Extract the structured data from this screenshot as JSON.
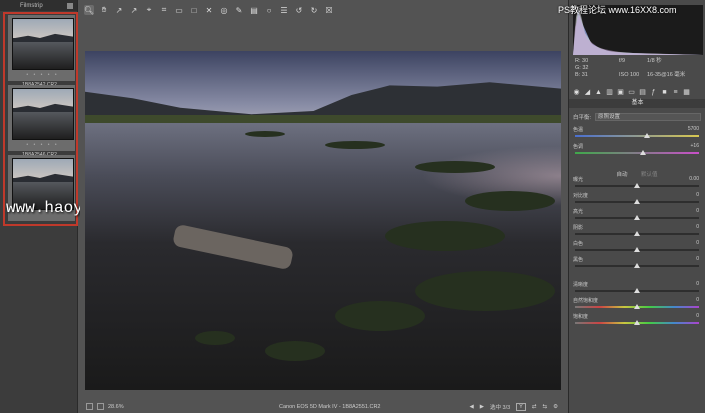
{
  "filmstrip": {
    "title": "Filmstrip",
    "items": [
      {
        "name": "1B8A2542.CR2",
        "stars": "• • • • •"
      },
      {
        "name": "1B8A2546.CR2",
        "stars": "• • • • •"
      },
      {
        "name": "1B8A2551.CR2",
        "stars": "• • • • •"
      }
    ]
  },
  "watermark": "www.haoyidiansheji.com",
  "ps_watermark": "PS教程论坛 www.16XX8.com",
  "info": {
    "r": "R:  30",
    "g": "G:  32",
    "b": "B:  31",
    "aperture": "f/9",
    "shutter": "1/8 秒",
    "iso": "ISO 100",
    "lens": "16-35@16 毫米"
  },
  "panel": {
    "title": "基本",
    "wb_label": "白平衡:",
    "wb_value": "原照设置",
    "auto": "自动",
    "default": "默认值",
    "sliders": [
      {
        "label": "色温",
        "value": "5700",
        "pos": 0.58
      },
      {
        "label": "色调",
        "value": "+16",
        "pos": 0.55
      },
      {
        "label": "曝光",
        "value": "0.00",
        "pos": 0.5
      },
      {
        "label": "对比度",
        "value": "0",
        "pos": 0.5
      },
      {
        "label": "高光",
        "value": "0",
        "pos": 0.5
      },
      {
        "label": "阴影",
        "value": "0",
        "pos": 0.5
      },
      {
        "label": "白色",
        "value": "0",
        "pos": 0.5
      },
      {
        "label": "黑色",
        "value": "0",
        "pos": 0.5
      },
      {
        "label": "清晰度",
        "value": "0",
        "pos": 0.5
      },
      {
        "label": "自然饱和度",
        "value": "0",
        "pos": 0.5
      },
      {
        "label": "饱和度",
        "value": "0",
        "pos": 0.5
      }
    ]
  },
  "statusbar": {
    "zoom": "28.6%",
    "camera": "Canon EOS 5D Mark IV  -  1B8A2551.CR2",
    "selection": "选中 3/3",
    "y_label": "Y"
  }
}
